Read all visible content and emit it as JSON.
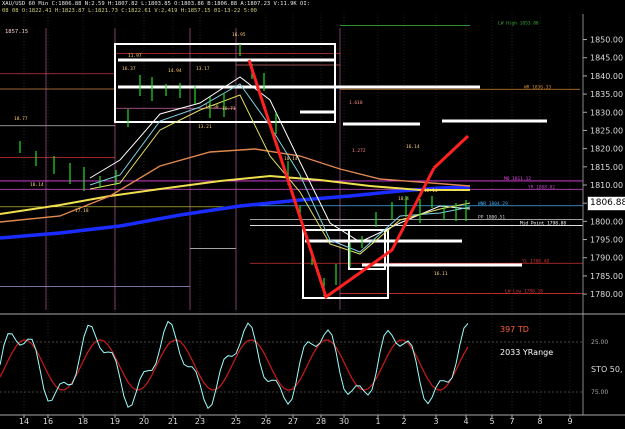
{
  "header": {
    "line1": "XAU/USD 60 Min C:1806.88 N:2.59 H:1807.82 L:1803.85 O:1803.86 B:1806.88 A:1807.23 V:11.9K OI:",
    "line2": "08 08 O:1822.41 H:1823.87 L:1821.73 C:1822.61 V:2,419 H:1857.15 01-13-22 5:00",
    "ref_price": "1857.15"
  },
  "current_price": "1806.88",
  "price_axis": {
    "ticks": [
      "1850.00",
      "1845.00",
      "1840.00",
      "1835.00",
      "1830.00",
      "1825.00",
      "1820.00",
      "1815.00",
      "1810.00",
      "1805.00",
      "1800.00",
      "1795.00",
      "1790.00",
      "1785.00",
      "1780.00"
    ],
    "min": 1777,
    "max": 1854
  },
  "date_axis": [
    "14",
    "16",
    "18",
    "19",
    "20",
    "21",
    "23",
    "25",
    "26",
    "27",
    "28",
    "30",
    "1",
    "2",
    "3",
    "4",
    "5",
    "7",
    "8",
    "9"
  ],
  "level_labels": {
    "lw_high": "LW High 1853.88",
    "wr": "WR 1836.33",
    "mo": "MO 1811.12",
    "yr": "YR 1808.82",
    "wnr": "WNR 1804.29",
    "mid": "Mid Point 1798.88",
    "pp": "PP 1800.51",
    "yl": "YL 1788.48",
    "lw_low": "LW Low 1780.18",
    "pct1": "1.272",
    "pct2": "1.618"
  },
  "bar_labels": [
    "18.77",
    "11.97",
    "16.95",
    "14.94",
    "13.17",
    "14.50",
    "16.37",
    "17.18",
    "13.21",
    "16.71",
    "10.14",
    "18.4",
    "16.14",
    "12.14",
    "16.11",
    "18.14"
  ],
  "oscillator": {
    "td_label": "397 TD",
    "range_label": "2033 YRange",
    "name_label": "STO 50,",
    "axis_labels": [
      "25.00",
      "75.00"
    ]
  },
  "colors": {
    "background": "#000000",
    "red_arrow": "#ff2020",
    "blue_ma": "#1a2cff",
    "yellow_ma": "#f0e050",
    "green_bars": "#22dd22",
    "osc_cyan": "#9ff",
    "osc_red": "#cc1a1a"
  }
}
